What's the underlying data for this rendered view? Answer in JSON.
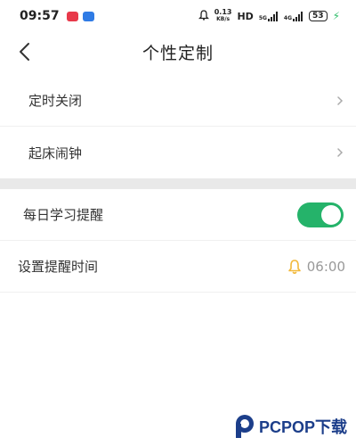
{
  "status_bar": {
    "time": "09:57",
    "badge_colors": [
      "#e8394a",
      "#2f7be5"
    ],
    "net_speed_value": "0.13",
    "net_speed_unit": "KB/s",
    "hd_label": "HD",
    "signal1_label": "5G",
    "signal2_label": "4G",
    "battery_level": "53"
  },
  "header": {
    "title": "个性定制"
  },
  "settings": {
    "timer_off_label": "定时关闭",
    "alarm_label": "起床闹钟",
    "daily_reminder_label": "每日学习提醒",
    "daily_reminder_enabled": true,
    "reminder_time_label": "设置提醒时间",
    "reminder_time_value": "06:00"
  },
  "colors": {
    "toggle_on": "#25b36a",
    "bell_icon": "#f2b93b",
    "watermark_blue": "#1c3e8a"
  },
  "watermark": {
    "text": "PCPOP下载"
  }
}
